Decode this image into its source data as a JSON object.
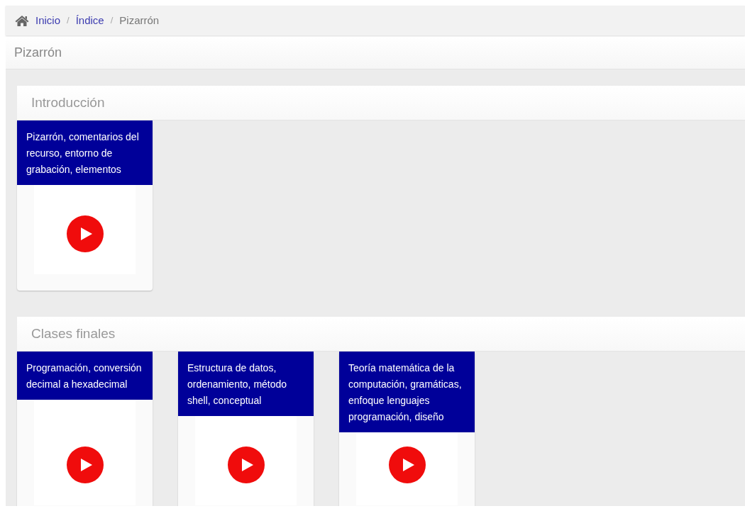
{
  "breadcrumb": [
    {
      "label": "Inicio",
      "kind": "link"
    },
    {
      "label": "Índice",
      "kind": "link"
    },
    {
      "label": "Pizarrón",
      "kind": "current"
    }
  ],
  "breadcrumb_separator": "/",
  "page_title": "Pizarrón",
  "sections": [
    {
      "title": "Introducción",
      "cards": [
        {
          "title": "Pizarrón, comentarios del recurso, entorno de grabación, elementos"
        }
      ]
    },
    {
      "title": "Clases finales",
      "cards": [
        {
          "title": "Programación, conversión decimal a hexadecimal"
        },
        {
          "title": "Estructura de datos, ordenamiento, método shell, conceptual"
        },
        {
          "title": "Teoría matemática de la computación, gramáticas, enfoque lenguajes programación, diseño"
        }
      ]
    }
  ]
}
